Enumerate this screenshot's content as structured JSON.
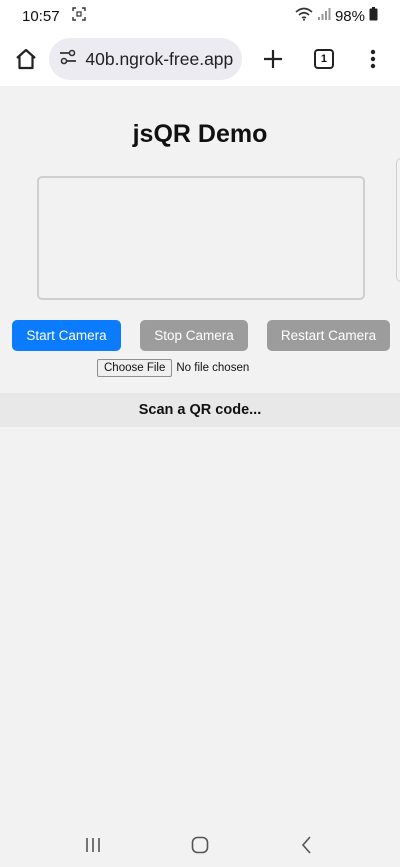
{
  "status_bar": {
    "time": "10:57",
    "battery": "98%",
    "icons": [
      "screenshot-icon",
      "wifi-icon",
      "signal-icon",
      "battery-icon"
    ]
  },
  "browser": {
    "url": "40b.ngrok-free.app",
    "tab_count": "1",
    "icons": [
      "home-icon",
      "site-settings-icon",
      "plus-icon",
      "tabs-icon",
      "menu-icon"
    ]
  },
  "page": {
    "title": "jsQR Demo",
    "buttons": {
      "start": "Start Camera",
      "stop": "Stop Camera",
      "restart": "Restart Camera"
    },
    "file_input": {
      "button_label": "Choose File",
      "status": "No file chosen"
    },
    "scan_status": "Scan a QR code...",
    "colors": {
      "primary_button": "#0b7cff",
      "secondary_button": "#9c9c9c"
    }
  },
  "nav_bar": {
    "icons": [
      "recent-apps-icon",
      "home-nav-icon",
      "back-icon"
    ]
  }
}
